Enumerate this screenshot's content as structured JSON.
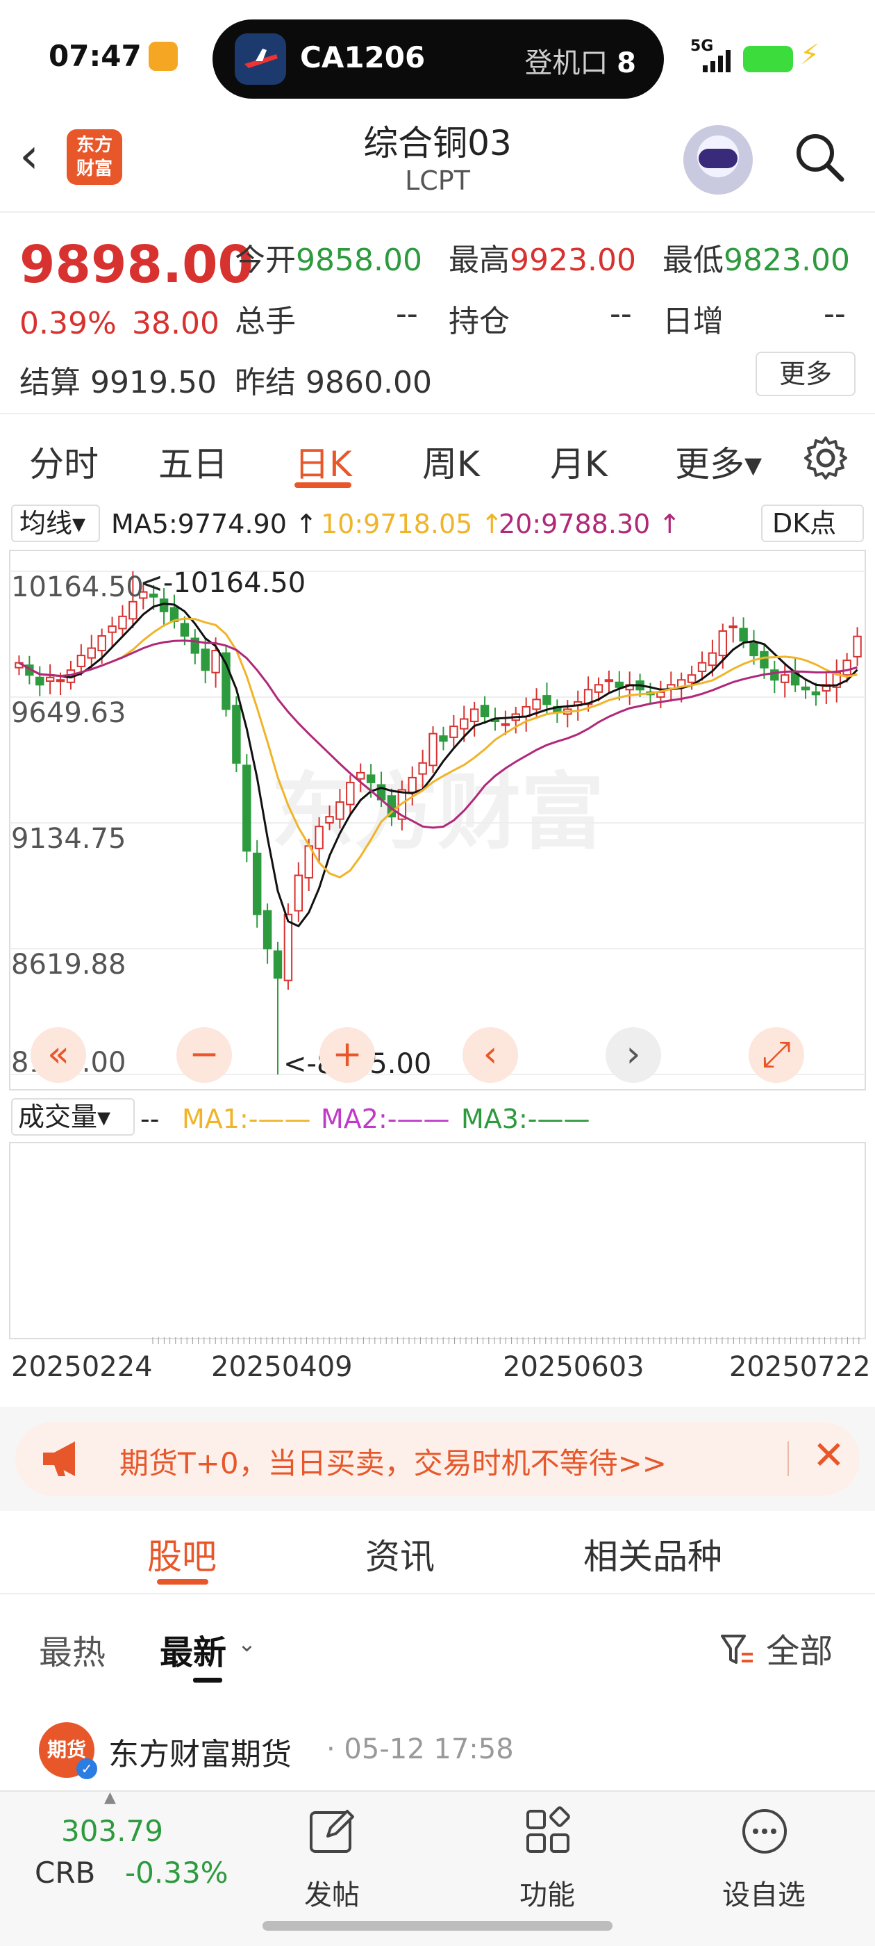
{
  "status_bar": {
    "time": "07:47",
    "flight": "CA1206",
    "gate_label": "登机口",
    "gate_no": "8",
    "network": "5G"
  },
  "header": {
    "back_icon": "chevron-left-icon",
    "logo_text": "东方财富",
    "title": "综合铜03",
    "subtitle": "LCPT"
  },
  "quote": {
    "price": "9898.00",
    "change_pct": "0.39%",
    "change": "38.00",
    "open_label": "今开",
    "open": "9858.00",
    "high_label": "最高",
    "high": "9923.00",
    "low_label": "最低",
    "low": "9823.00",
    "volume_label": "总手",
    "volume": "--",
    "oi_label": "持仓",
    "oi": "--",
    "daily_inc_label": "日增",
    "daily_inc": "--",
    "settle_label": "结算",
    "settle": "9919.50",
    "prev_settle_label": "昨结",
    "prev_settle": "9860.00",
    "more_label": "更多"
  },
  "period_tabs": [
    "分时",
    "五日",
    "日K",
    "周K",
    "月K",
    "更多▾"
  ],
  "active_period": "日K",
  "ma_bar": {
    "selector": "均线▾",
    "ma5": "MA5:9774.90 ↑",
    "ma10": "10:9718.05 ↑",
    "ma20": "20:9788.30 ↑",
    "dk": "DK点"
  },
  "watermark": "东方财富",
  "chart_data": {
    "type": "candlestick",
    "y_ticks": [
      "10164.50",
      "9649.63",
      "9134.75",
      "8619.88",
      "8105.00"
    ],
    "ylim": [
      8105.0,
      10164.5
    ],
    "max_label": "<-10164.50",
    "min_label": "<-8105.00",
    "x_ticks": [
      "20250224",
      "20250409",
      "20250603",
      "20250722"
    ],
    "closes": [
      9790,
      9740,
      9700,
      9730,
      9720,
      9760,
      9820,
      9850,
      9900,
      9940,
      9980,
      10040,
      10080,
      10060,
      10000,
      9960,
      9900,
      9830,
      9760,
      9840,
      9600,
      9380,
      9020,
      8760,
      8620,
      8500,
      8760,
      8920,
      9040,
      9120,
      9160,
      9220,
      9300,
      9340,
      9300,
      9230,
      9160,
      9270,
      9320,
      9380,
      9500,
      9470,
      9530,
      9560,
      9600,
      9570,
      9550,
      9540,
      9580,
      9610,
      9640,
      9620,
      9590,
      9600,
      9630,
      9680,
      9700,
      9720,
      9690,
      9700,
      9680,
      9660,
      9670,
      9700,
      9720,
      9740,
      9790,
      9830,
      9920,
      9940,
      9880,
      9820,
      9770,
      9720,
      9740,
      9700,
      9680,
      9660,
      9700,
      9750,
      9800,
      9898
    ],
    "series": [
      {
        "name": "MA5",
        "color": "#111111"
      },
      {
        "name": "10",
        "color": "#f0b429"
      },
      {
        "name": "20",
        "color": "#b0287a"
      }
    ]
  },
  "nav_buttons": [
    "double-chevron-left-icon",
    "zoom-out-icon",
    "zoom-in-icon",
    "chevron-left-icon",
    "chevron-right-icon",
    "expand-icon"
  ],
  "volume_bar": {
    "selector": "成交量▾",
    "value": "--",
    "ma1": "MA1:-——",
    "ma2": "MA2:-——",
    "ma3": "MA3:-——"
  },
  "banner": {
    "text": "期货T+0，当日买卖，交易时机不等待>>"
  },
  "content_tabs": [
    "股吧",
    "资讯",
    "相关品种"
  ],
  "sub_tabs": {
    "hot": "最热",
    "latest": "最新",
    "filter": "全部"
  },
  "post": {
    "avatar_text": "期货",
    "author": "东方财富期货",
    "time": "· 05-12 17:58"
  },
  "bottom_bar": {
    "crb_value": "303.79",
    "crb_label": "CRB",
    "crb_change": "-0.33%",
    "post_label": "发帖",
    "function_label": "功能",
    "watchlist_label": "设自选"
  }
}
